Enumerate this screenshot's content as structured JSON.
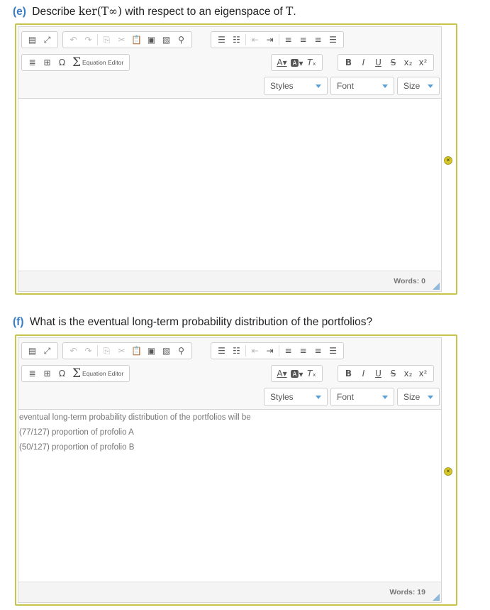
{
  "questions": [
    {
      "label": "(e)",
      "text_before": "Describe",
      "math": "ker(T∞)",
      "text_after": "with respect to an eigenspace of",
      "math2": "T",
      "text_end": ".",
      "words": "Words: 0",
      "lines": []
    },
    {
      "label": "(f)",
      "text_before": "What is the eventual long-term probability distribution of the portfolios?",
      "math": "",
      "text_after": "",
      "math2": "",
      "text_end": "",
      "words": "Words: 19",
      "lines": [
        "eventual long-term probability distribution of the portfolios will be",
        "(77/127) proportion of profolio A",
        "(50/127) proportion of profolio B"
      ]
    }
  ],
  "toolbar": {
    "row1_icons": [
      "source-icon",
      "maximize-icon",
      "undo-icon",
      "redo-icon",
      "copy-icon",
      "cut-icon",
      "paste-icon",
      "paste-text-icon",
      "paste-word-icon",
      "find-icon",
      "numbered-list-icon",
      "bulleted-list-icon",
      "outdent-icon",
      "indent-icon",
      "align-left-icon",
      "align-center-icon",
      "align-right-icon",
      "justify-icon"
    ],
    "equation_label": "Equation Editor",
    "styles": "Styles",
    "font": "Font",
    "size": "Size"
  },
  "colors": {
    "border": "#c8c34d",
    "label": "#3a7cc4",
    "status": "#d6c92e"
  }
}
